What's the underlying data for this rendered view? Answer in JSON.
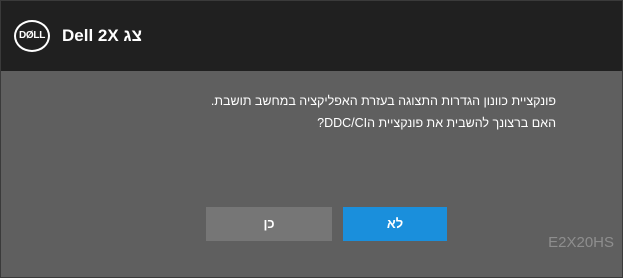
{
  "header": {
    "logo_text": "DØLL",
    "title": "Dell 2X צג"
  },
  "dialog": {
    "message_line1": "פונקציית כוונון הגדרות התצוגה בעזרת האפליקציה במחשב תושבת.",
    "message_line2": "האם ברצונך להשבית את פונקציית הDDC/CI?",
    "no_label": "לא",
    "yes_label": "כן"
  },
  "footer": {
    "model": "E2X20HS"
  },
  "colors": {
    "title_bar": "#202020",
    "panel": "#5f5f5f",
    "no_button": "#1a8fdc",
    "yes_button": "#767676",
    "model_text": "#8e8e8e"
  }
}
